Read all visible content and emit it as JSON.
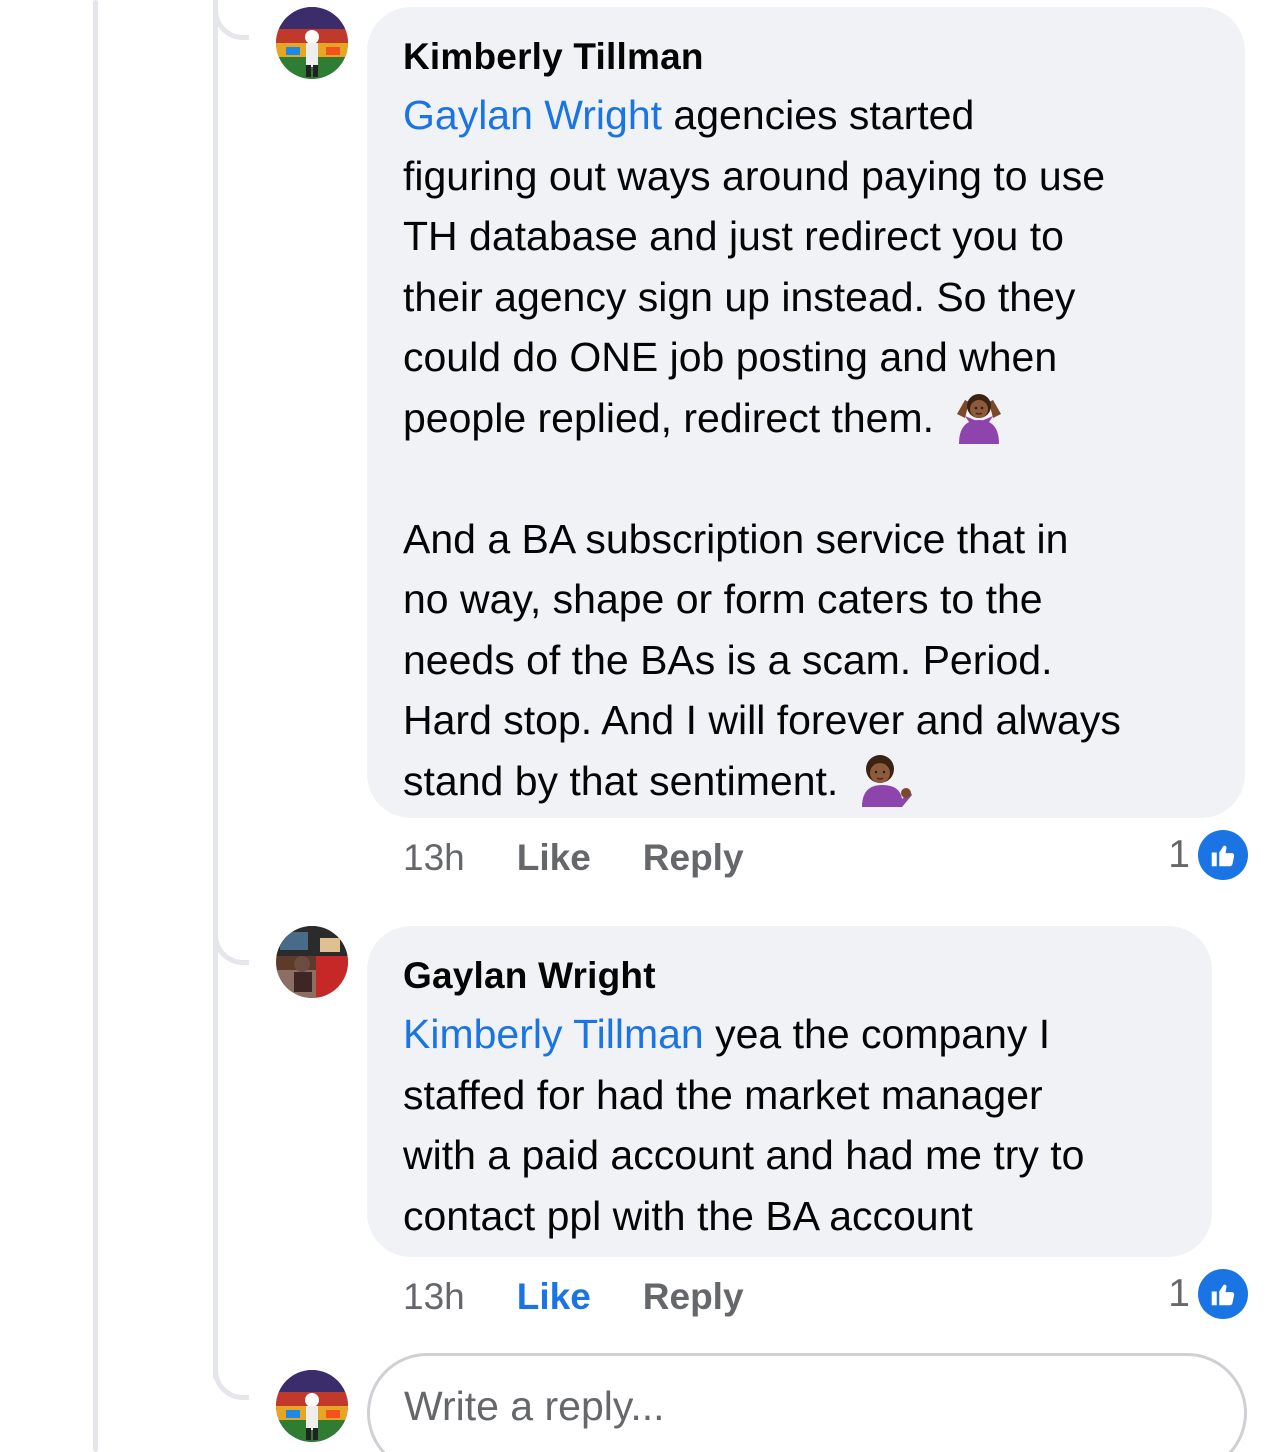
{
  "comments": [
    {
      "author": "Kimberly Tillman",
      "mention": "Gaylan Wright",
      "text": " agencies started\nfiguring out ways around paying to use\nTH database and just redirect you to\ntheir agency sign up instead. So they\ncould do ONE job posting and when\npeople replied, redirect them.",
      "emoji_1": "person-shrugging-emoji",
      "text2": "\n\nAnd a BA subscription service that in\nno way, shape or form caters to the\nneeds of the BAs is a scam. Period.\nHard stop. And I will forever and always\nstand by that sentiment.",
      "emoji_2": "person-tipping-hand-emoji",
      "time": "13h",
      "like": "Like",
      "reply": "Reply",
      "reaction_count": "1",
      "liked": false
    },
    {
      "author": "Gaylan Wright",
      "mention": "Kimberly Tillman",
      "text": " yea the company I\nstaffed for had the market manager\nwith a paid account and had me try to\ncontact ppl with the BA account",
      "time": "13h",
      "like": "Like",
      "reply": "Reply",
      "reaction_count": "1",
      "liked": true
    }
  ],
  "reply_input": {
    "placeholder": "Write a reply..."
  },
  "colors": {
    "accent": "#1b74e4",
    "bubble": "#f0f2f5",
    "muted": "#65676b"
  }
}
